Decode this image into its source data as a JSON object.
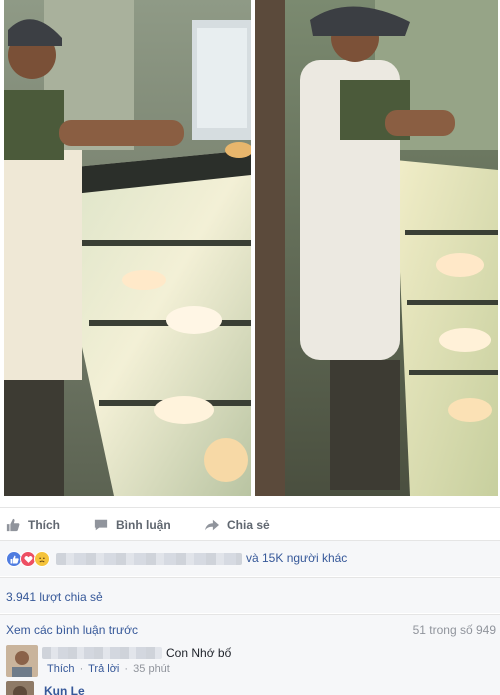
{
  "actions": {
    "like_label": "Thích",
    "comment_label": "Bình luận",
    "share_label": "Chia sẻ"
  },
  "reactions": {
    "others_text": "và 15K người khác",
    "icons": [
      "like-icon",
      "love-icon",
      "sad-icon"
    ]
  },
  "shares": {
    "text": "3.941 lượt chia sẻ"
  },
  "comments": {
    "view_previous": "Xem các bình luận trước",
    "count_text": "51 trong số 949",
    "items": [
      {
        "text": "Con Nhớ bố",
        "like": "Thích",
        "separator": "·",
        "reply": "Trả lời",
        "time": "35 phút"
      },
      {
        "name": "Kun Le"
      }
    ]
  },
  "colors": {
    "link": "#365899",
    "meta": "#90949c",
    "panel": "#f6f7f9",
    "like": "#4f7ce0",
    "love": "#ed4f63",
    "sad": "#f5c33b"
  }
}
